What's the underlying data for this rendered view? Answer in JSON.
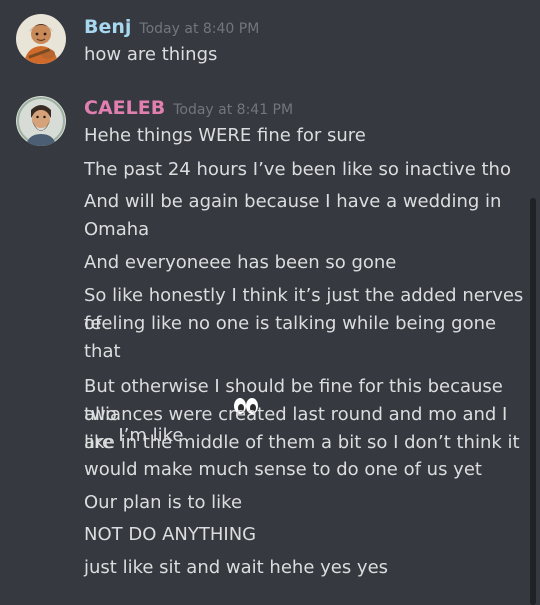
{
  "messages": [
    {
      "author": "Benj",
      "author_color": "#a8d8f0",
      "timestamp": "Today at 8:40 PM",
      "lines": [
        "how are things"
      ]
    },
    {
      "author": "CAELEB",
      "author_color": "#e07fb0",
      "timestamp": "Today at 8:41 PM",
      "lines": [
        "Hehe things WERE fine for sure",
        "The past 24 hours I’ve been like so inactive tho",
        "And will be again because I have a wedding in",
        "Omaha",
        "And everyoneee has been so gone",
        "So like honestly I think it’s just the added nerves of",
        "feeling like no one is talking while being gone that",
        "I’m like",
        "But otherwise I should be fine for this because two",
        "alliances were created last round and mo and I are",
        "like in the middle of them a bit so I don’t think it",
        "would make much sense to do one of us yet",
        "Our plan is to like",
        "NOT DO ANYTHING",
        "just like sit and wait hehe yes yes"
      ],
      "emoji": "eyes-emoji"
    }
  ],
  "icons": {
    "benj_avatar": "avatar-character-with-guitar",
    "caeleb_avatar": "avatar-bearded-man",
    "eyes": "eyes-emoji"
  },
  "colors": {
    "background": "#36393f",
    "text": "#dcddde",
    "timestamp": "#72767d"
  }
}
